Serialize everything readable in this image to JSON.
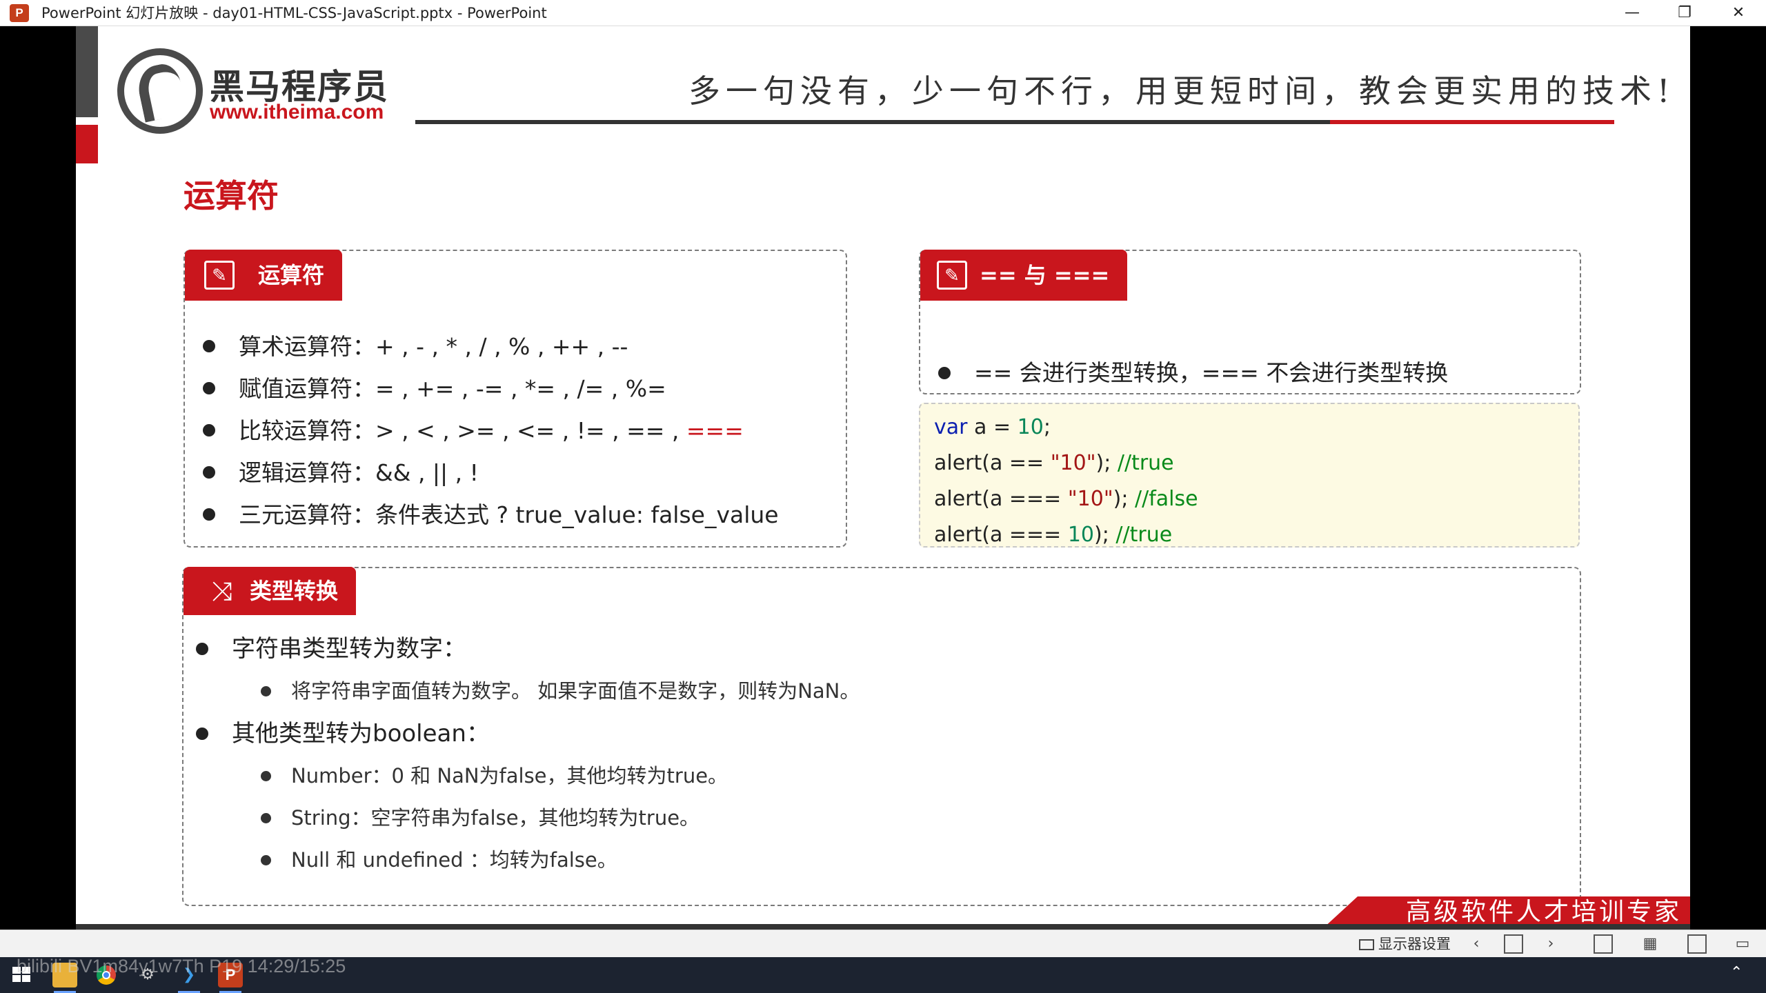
{
  "window": {
    "title": "PowerPoint 幻灯片放映  -  day01-HTML-CSS-JavaScript.pptx - PowerPoint",
    "app_icon": "P",
    "min_glyph": "—",
    "max_glyph": "❐",
    "close_glyph": "✕"
  },
  "slide": {
    "logo_cn": "黑马程序员",
    "logo_url": "www.itheima.com",
    "slogan": "多一句没有，少一句不行，用更短时间，教会更实用的技术!",
    "page_title": "运算符",
    "operators_panel": {
      "tag": "运算符",
      "items": [
        {
          "text": "算术运算符：+ , - , * , / , % , ++ , --",
          "highlight": ""
        },
        {
          "text": "赋值运算符：= , += , -= , *= , /= , %=",
          "highlight": ""
        },
        {
          "text": "比较运算符：> , < , >= , <= , != , == , ",
          "highlight": "==="
        },
        {
          "text": "逻辑运算符：&& , || , !",
          "highlight": ""
        },
        {
          "text": "三元运算符：条件表达式 ? true_value: false_value",
          "highlight": ""
        }
      ]
    },
    "equality_panel": {
      "tag": "== 与 ===",
      "item": "== 会进行类型转换，=== 不会进行类型转换"
    },
    "code": {
      "line1": {
        "kw": "var",
        "rest": " a = ",
        "num": "10",
        "end": ";"
      },
      "line2": {
        "a": "alert(a == ",
        "str": "\"10\"",
        "b": "); ",
        "comment": "//true"
      },
      "line3": {
        "a": "alert(a === ",
        "str": "\"10\"",
        "b": "); ",
        "comment": "//false"
      },
      "line4": {
        "a": "alert(a === ",
        "num": "10",
        "b": "); ",
        "comment": "//true"
      }
    },
    "conversion_panel": {
      "tag": "类型转换",
      "string_to_number": "字符串类型转为数字：",
      "string_to_number_detail": "将字符串字面值转为数字。 如果字面值不是数字，则转为NaN。",
      "to_boolean": "其他类型转为boolean：",
      "boolean_details": [
        "Number：0 和 NaN为false，其他均转为true。",
        "String：空字符串为false，其他均转为true。",
        "Null 和 undefined ：均转为false。"
      ]
    },
    "footer": "高级软件人才培训专家"
  },
  "statusbar": {
    "display_settings": "显示器设置"
  },
  "overlay_text": "bilibili BV1m84y1w7Th P19 14:29/15:25",
  "colors": {
    "brand_red": "#c9161d",
    "dark_gray": "#4a4a4a",
    "code_bg": "#fdfae3"
  }
}
